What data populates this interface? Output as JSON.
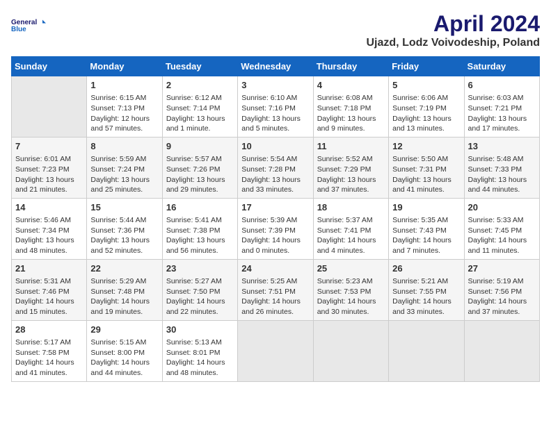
{
  "logo": {
    "line1": "General",
    "line2": "Blue"
  },
  "title": "April 2024",
  "subtitle": "Ujazd, Lodz Voivodeship, Poland",
  "days_of_week": [
    "Sunday",
    "Monday",
    "Tuesday",
    "Wednesday",
    "Thursday",
    "Friday",
    "Saturday"
  ],
  "weeks": [
    [
      {
        "num": "",
        "info": ""
      },
      {
        "num": "1",
        "info": "Sunrise: 6:15 AM\nSunset: 7:13 PM\nDaylight: 12 hours\nand 57 minutes."
      },
      {
        "num": "2",
        "info": "Sunrise: 6:12 AM\nSunset: 7:14 PM\nDaylight: 13 hours\nand 1 minute."
      },
      {
        "num": "3",
        "info": "Sunrise: 6:10 AM\nSunset: 7:16 PM\nDaylight: 13 hours\nand 5 minutes."
      },
      {
        "num": "4",
        "info": "Sunrise: 6:08 AM\nSunset: 7:18 PM\nDaylight: 13 hours\nand 9 minutes."
      },
      {
        "num": "5",
        "info": "Sunrise: 6:06 AM\nSunset: 7:19 PM\nDaylight: 13 hours\nand 13 minutes."
      },
      {
        "num": "6",
        "info": "Sunrise: 6:03 AM\nSunset: 7:21 PM\nDaylight: 13 hours\nand 17 minutes."
      }
    ],
    [
      {
        "num": "7",
        "info": "Sunrise: 6:01 AM\nSunset: 7:23 PM\nDaylight: 13 hours\nand 21 minutes."
      },
      {
        "num": "8",
        "info": "Sunrise: 5:59 AM\nSunset: 7:24 PM\nDaylight: 13 hours\nand 25 minutes."
      },
      {
        "num": "9",
        "info": "Sunrise: 5:57 AM\nSunset: 7:26 PM\nDaylight: 13 hours\nand 29 minutes."
      },
      {
        "num": "10",
        "info": "Sunrise: 5:54 AM\nSunset: 7:28 PM\nDaylight: 13 hours\nand 33 minutes."
      },
      {
        "num": "11",
        "info": "Sunrise: 5:52 AM\nSunset: 7:29 PM\nDaylight: 13 hours\nand 37 minutes."
      },
      {
        "num": "12",
        "info": "Sunrise: 5:50 AM\nSunset: 7:31 PM\nDaylight: 13 hours\nand 41 minutes."
      },
      {
        "num": "13",
        "info": "Sunrise: 5:48 AM\nSunset: 7:33 PM\nDaylight: 13 hours\nand 44 minutes."
      }
    ],
    [
      {
        "num": "14",
        "info": "Sunrise: 5:46 AM\nSunset: 7:34 PM\nDaylight: 13 hours\nand 48 minutes."
      },
      {
        "num": "15",
        "info": "Sunrise: 5:44 AM\nSunset: 7:36 PM\nDaylight: 13 hours\nand 52 minutes."
      },
      {
        "num": "16",
        "info": "Sunrise: 5:41 AM\nSunset: 7:38 PM\nDaylight: 13 hours\nand 56 minutes."
      },
      {
        "num": "17",
        "info": "Sunrise: 5:39 AM\nSunset: 7:39 PM\nDaylight: 14 hours\nand 0 minutes."
      },
      {
        "num": "18",
        "info": "Sunrise: 5:37 AM\nSunset: 7:41 PM\nDaylight: 14 hours\nand 4 minutes."
      },
      {
        "num": "19",
        "info": "Sunrise: 5:35 AM\nSunset: 7:43 PM\nDaylight: 14 hours\nand 7 minutes."
      },
      {
        "num": "20",
        "info": "Sunrise: 5:33 AM\nSunset: 7:45 PM\nDaylight: 14 hours\nand 11 minutes."
      }
    ],
    [
      {
        "num": "21",
        "info": "Sunrise: 5:31 AM\nSunset: 7:46 PM\nDaylight: 14 hours\nand 15 minutes."
      },
      {
        "num": "22",
        "info": "Sunrise: 5:29 AM\nSunset: 7:48 PM\nDaylight: 14 hours\nand 19 minutes."
      },
      {
        "num": "23",
        "info": "Sunrise: 5:27 AM\nSunset: 7:50 PM\nDaylight: 14 hours\nand 22 minutes."
      },
      {
        "num": "24",
        "info": "Sunrise: 5:25 AM\nSunset: 7:51 PM\nDaylight: 14 hours\nand 26 minutes."
      },
      {
        "num": "25",
        "info": "Sunrise: 5:23 AM\nSunset: 7:53 PM\nDaylight: 14 hours\nand 30 minutes."
      },
      {
        "num": "26",
        "info": "Sunrise: 5:21 AM\nSunset: 7:55 PM\nDaylight: 14 hours\nand 33 minutes."
      },
      {
        "num": "27",
        "info": "Sunrise: 5:19 AM\nSunset: 7:56 PM\nDaylight: 14 hours\nand 37 minutes."
      }
    ],
    [
      {
        "num": "28",
        "info": "Sunrise: 5:17 AM\nSunset: 7:58 PM\nDaylight: 14 hours\nand 41 minutes."
      },
      {
        "num": "29",
        "info": "Sunrise: 5:15 AM\nSunset: 8:00 PM\nDaylight: 14 hours\nand 44 minutes."
      },
      {
        "num": "30",
        "info": "Sunrise: 5:13 AM\nSunset: 8:01 PM\nDaylight: 14 hours\nand 48 minutes."
      },
      {
        "num": "",
        "info": ""
      },
      {
        "num": "",
        "info": ""
      },
      {
        "num": "",
        "info": ""
      },
      {
        "num": "",
        "info": ""
      }
    ]
  ]
}
